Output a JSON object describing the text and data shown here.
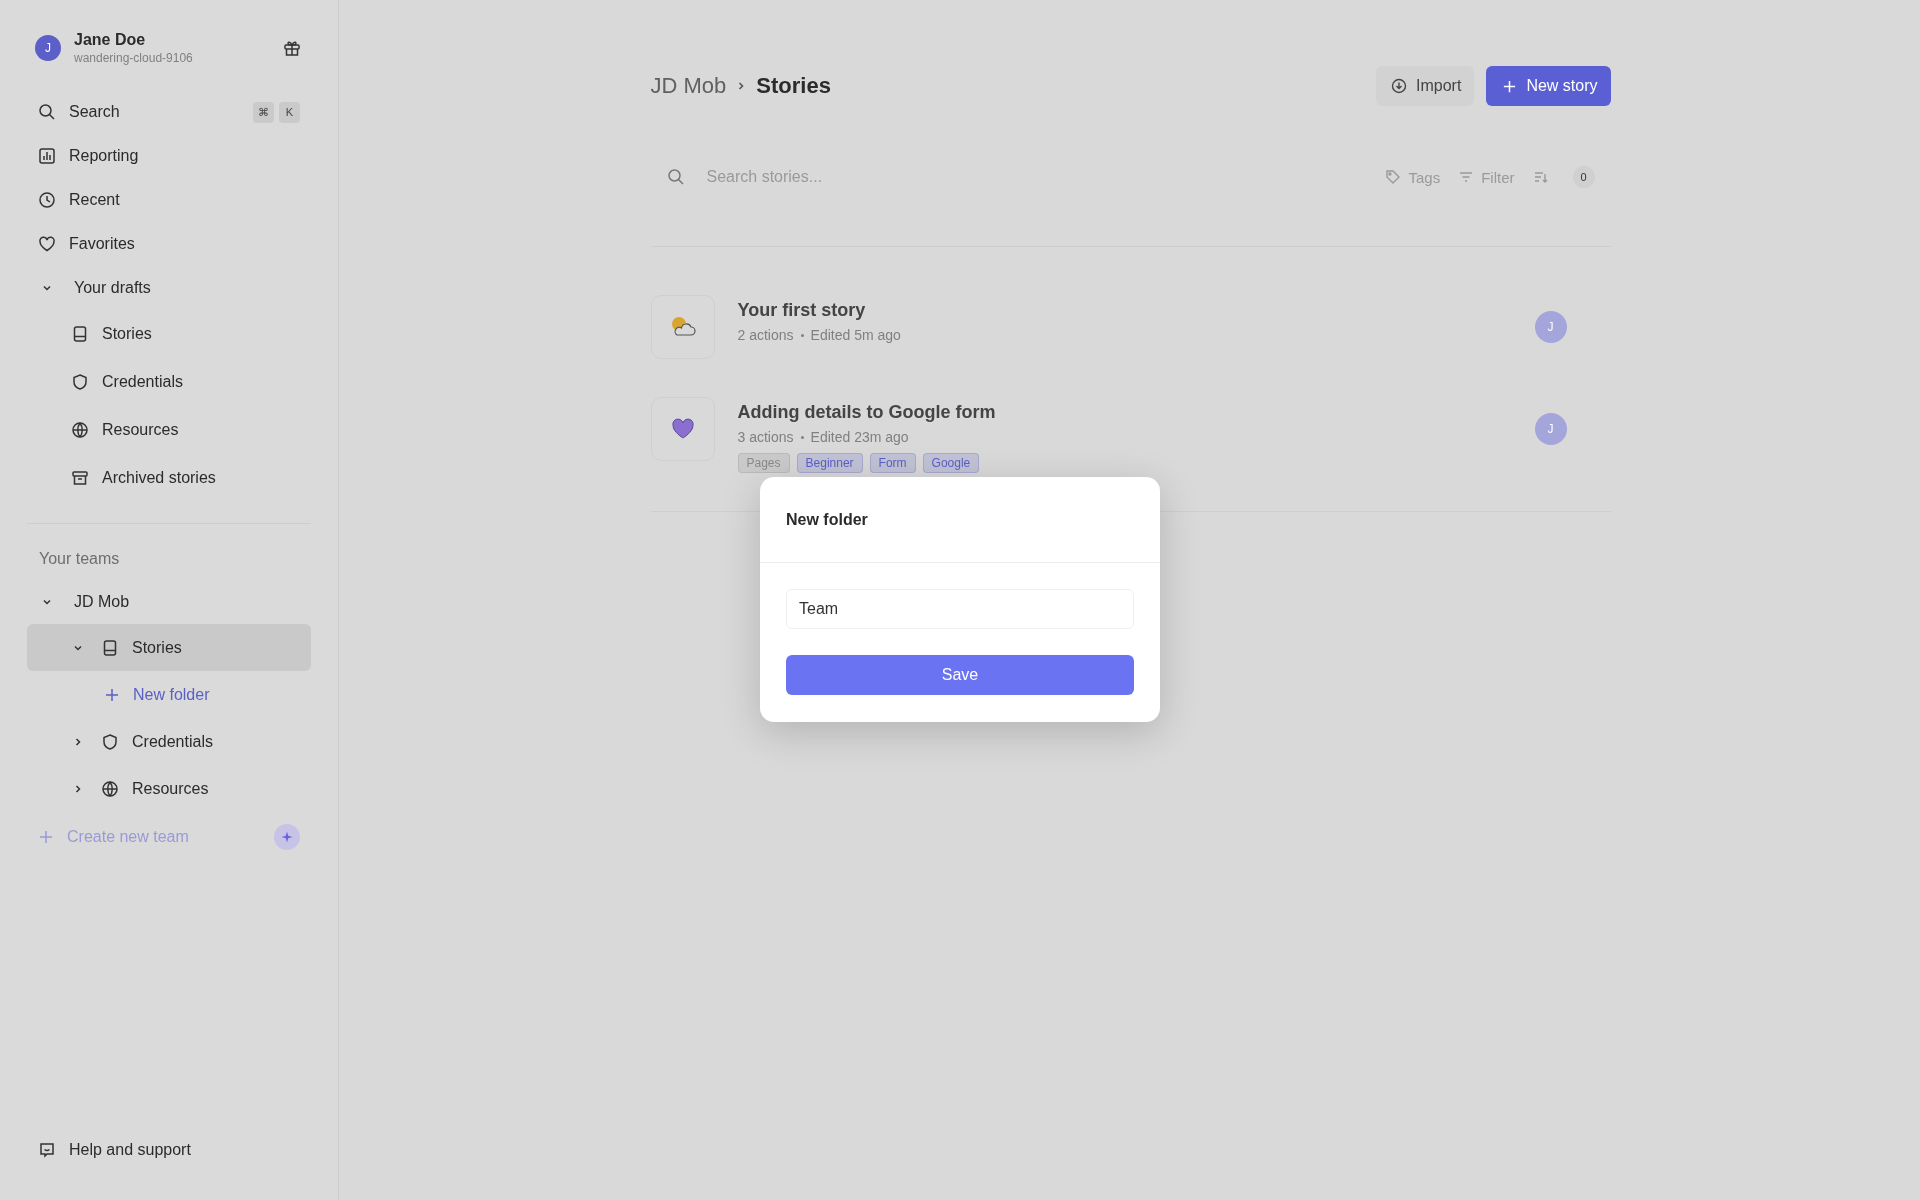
{
  "user": {
    "name": "Jane Doe",
    "handle": "wandering-cloud-9106",
    "initial": "J"
  },
  "nav": [
    {
      "label": "Search",
      "shortcut": [
        "⌘",
        "K"
      ]
    },
    {
      "label": "Reporting"
    },
    {
      "label": "Recent"
    },
    {
      "label": "Favorites"
    }
  ],
  "drafts": {
    "label": "Your drafts",
    "expanded": true,
    "items": [
      "Stories",
      "Credentials",
      "Resources",
      "Archived stories"
    ]
  },
  "teams_heading": "Your teams",
  "team": {
    "label": "JD Mob",
    "expanded": true,
    "items": [
      {
        "label": "Stories",
        "expanded": true,
        "selected": true,
        "children": [
          {
            "label": "New folder"
          }
        ]
      },
      {
        "label": "Credentials",
        "expanded": false,
        "selected": false
      },
      {
        "label": "Resources",
        "expanded": false,
        "selected": false
      }
    ]
  },
  "create_team": "Create new team",
  "help": "Help and support",
  "breadcrumb": [
    "JD Mob",
    "Stories"
  ],
  "buttons": {
    "import": "Import",
    "new_story": "New story"
  },
  "search": {
    "placeholder": "Search stories..."
  },
  "toolbar": {
    "tags": "Tags",
    "filter": "Filter",
    "count": "0"
  },
  "stories": [
    {
      "title": "Your first story",
      "actions": "2 actions",
      "edited": "Edited 5m ago",
      "avatar": "J"
    },
    {
      "title": "Adding details to Google form",
      "actions": "3 actions",
      "edited": "Edited 23m ago",
      "avatar": "J",
      "tags": [
        {
          "label": "Pages",
          "color": "#8a8a8a"
        },
        {
          "label": "Beginner",
          "color": "#5b5fc7"
        },
        {
          "label": "Form",
          "color": "#5b5fc7"
        },
        {
          "label": "Google",
          "color": "#5b5fc7"
        }
      ]
    }
  ],
  "dialog": {
    "title": "New folder",
    "value": "Team",
    "button": "Save"
  }
}
